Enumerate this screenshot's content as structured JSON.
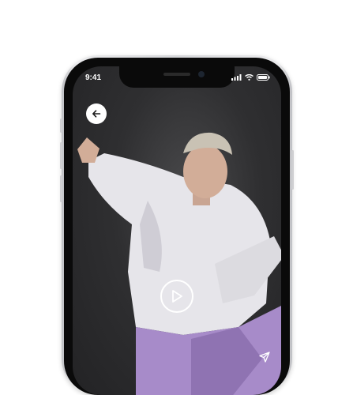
{
  "status_bar": {
    "time": "9:41",
    "icons": [
      "signal-icon",
      "wifi-icon",
      "battery-icon"
    ]
  },
  "video_player": {
    "back_icon": "arrow-left-icon",
    "play_icon": "play-icon",
    "share_icon": "send-icon"
  },
  "colors": {
    "screen_bg": "#2f2f31",
    "sweater": "#e6e5ea",
    "pants": "#a78bc9",
    "icon_fg": "#ffffff"
  }
}
